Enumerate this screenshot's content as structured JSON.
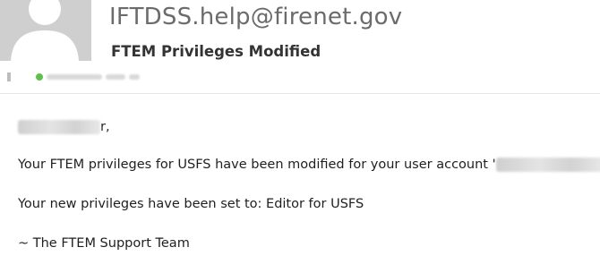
{
  "email": {
    "sender": "IFTDSS.help@firenet.gov",
    "subject": "FTEM Privileges Modified",
    "icons": [
      "avatar-silhouette",
      "presence-dot"
    ],
    "colors": {
      "presence": "#5ec14e",
      "sender_text": "#6b6b6b"
    }
  },
  "body": {
    "greeting_suffix": "r,",
    "line1": "Your FTEM privileges for USFS have been modified for your user account '",
    "line2": "Your new privileges have been set to: Editor for USFS",
    "signature": "~ The FTEM Support Team"
  }
}
